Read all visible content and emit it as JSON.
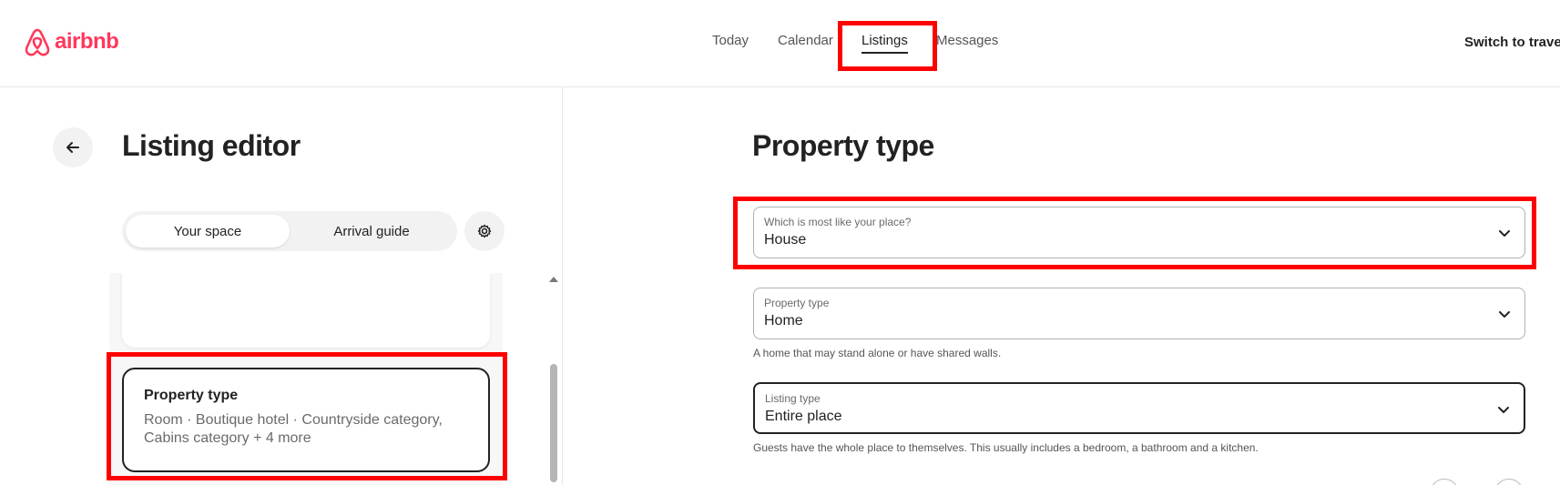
{
  "header": {
    "brand": "airbnb",
    "nav": [
      {
        "label": "Today"
      },
      {
        "label": "Calendar"
      },
      {
        "label": "Listings"
      },
      {
        "label": "Messages"
      }
    ],
    "switch_label": "Switch to travell"
  },
  "left": {
    "title": "Listing editor",
    "toggle": {
      "your_space": "Your space",
      "arrival_guide": "Arrival guide"
    },
    "property_card": {
      "title": "Property type",
      "subtitle": "Room · Boutique hotel · Countryside category, Cabins category + 4 more"
    }
  },
  "right": {
    "title": "Property type",
    "place_select": {
      "label": "Which is most like your place?",
      "value": "House"
    },
    "property_select": {
      "label": "Property type",
      "value": "Home",
      "helper": "A home that may stand alone or have shared walls."
    },
    "listing_select": {
      "label": "Listing type",
      "value": "Entire place",
      "helper": "Guests have the whole place to themselves. This usually includes a bedroom, a bathroom and a kitchen."
    }
  },
  "colors": {
    "brand": "#ff385c",
    "highlight": "#ff0000",
    "text": "#222222"
  }
}
